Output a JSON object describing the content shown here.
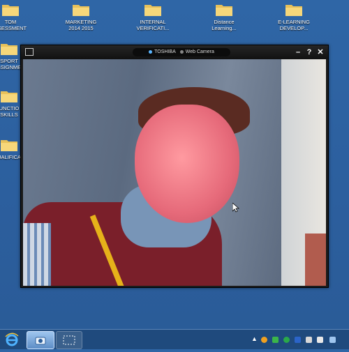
{
  "desktop_icons": [
    {
      "label_l1": "TOM",
      "label_l2": "SSESSMENT"
    },
    {
      "label_l1": "MARKETING",
      "label_l2": "2014 2015"
    },
    {
      "label_l1": "INTERNAL",
      "label_l2": "VERIFICATI..."
    },
    {
      "label_l1": "Distance",
      "label_l2": "Learning..."
    },
    {
      "label_l1": "E-LEARNING",
      "label_l2": "DEVELOP..."
    },
    {
      "label_l1": "SPORT",
      "label_l2": "SSIGNME"
    },
    {
      "label_l1": "UNCTIO",
      "label_l2": "SKILLS"
    },
    {
      "label_l1": "UALIFICA",
      "label_l2": ""
    }
  ],
  "camera_window": {
    "brand": "TOSHIBA",
    "app_title": "Web Camera",
    "minimize": "–",
    "help": "?",
    "close": "✕"
  },
  "taskbar": {
    "start_icon": "ie-icon",
    "apps": [
      "internet-explorer",
      "camera-app",
      "snipping-tool"
    ],
    "tray": [
      "tray-arrow",
      "tray-orange",
      "tray-green",
      "tray-sync",
      "tray-word",
      "tray-network",
      "tray-volume",
      "tray-signal"
    ]
  },
  "colors": {
    "desktop": "#2c5f9e",
    "taskbar": "#1f4a7d",
    "window": "#1b1b1b"
  }
}
